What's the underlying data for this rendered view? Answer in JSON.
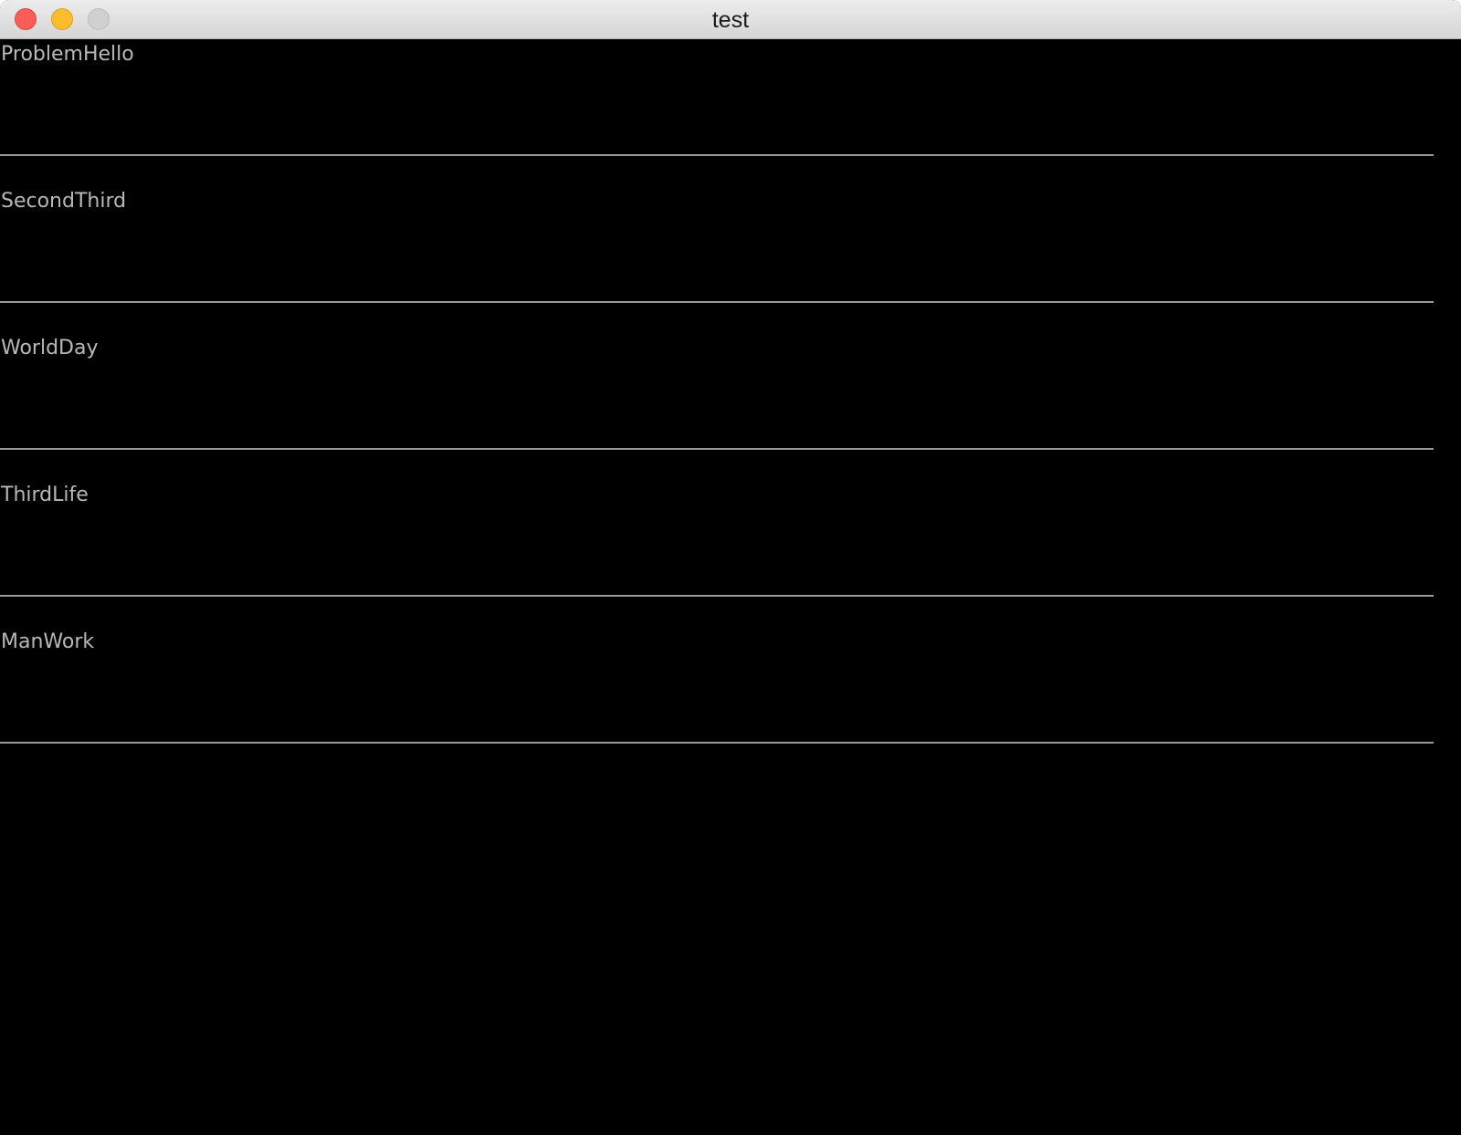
{
  "window": {
    "title": "test",
    "controls": {
      "close": "close-icon",
      "minimize": "minimize-icon",
      "zoom": "zoom-icon"
    }
  },
  "list": {
    "items": [
      {
        "label": "ProblemHello"
      },
      {
        "label": "SecondThird"
      },
      {
        "label": "WorldDay"
      },
      {
        "label": "ThirdLife"
      },
      {
        "label": "ManWork"
      }
    ]
  },
  "colors": {
    "background": "#000000",
    "text": "#b8b8b8",
    "separator": "#9a9a9a",
    "close": "#fc5d57",
    "minimize": "#fdbc2e",
    "zoom": "#d0d0d0"
  }
}
